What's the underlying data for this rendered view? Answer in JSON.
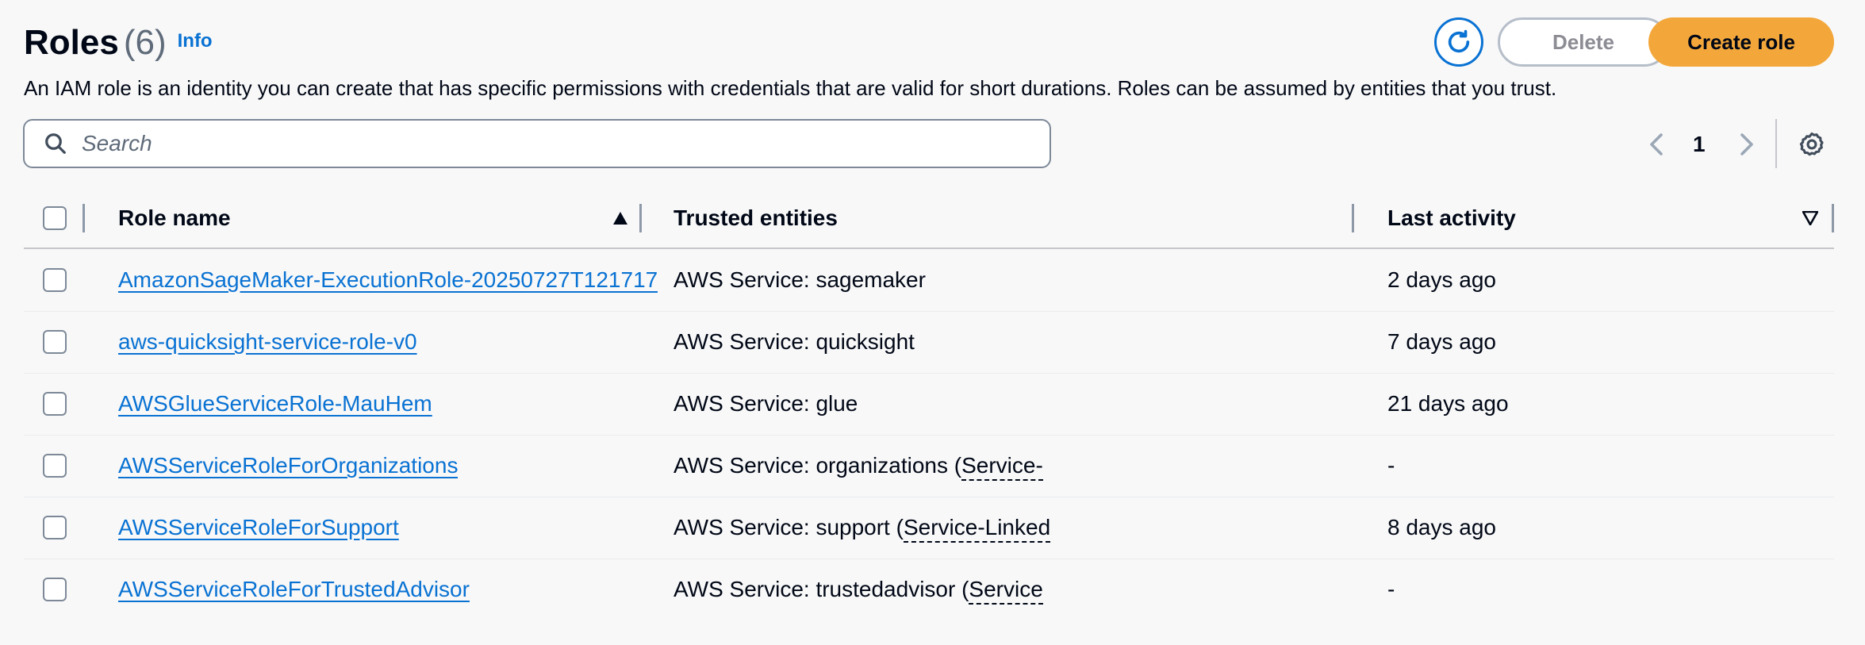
{
  "header": {
    "title": "Roles",
    "count": "(6)",
    "info_label": "Info",
    "description": "An IAM role is an identity you can create that has specific permissions with credentials that are valid for short durations. Roles can be assumed by entities that you trust."
  },
  "actions": {
    "refresh_icon": "refresh-icon",
    "delete_label": "Delete",
    "create_label": "Create role"
  },
  "search": {
    "placeholder": "Search"
  },
  "pagination": {
    "current_page": "1"
  },
  "table": {
    "columns": [
      "Role name",
      "Trusted entities",
      "Last activity"
    ],
    "rows": [
      {
        "role_name": "AmazonSageMaker-ExecutionRole-20250727T121717",
        "trusted": "AWS Service: sagemaker",
        "trusted_suffix": "",
        "last_activity": "2 days ago"
      },
      {
        "role_name": "aws-quicksight-service-role-v0",
        "trusted": "AWS Service: quicksight",
        "trusted_suffix": "",
        "last_activity": "7 days ago"
      },
      {
        "role_name": "AWSGlueServiceRole-MauHem",
        "trusted": "AWS Service: glue",
        "trusted_suffix": "",
        "last_activity": "21 days ago"
      },
      {
        "role_name": "AWSServiceRoleForOrganizations",
        "trusted": "AWS Service: organizations",
        "trusted_suffix": "Service-",
        "last_activity": "-"
      },
      {
        "role_name": "AWSServiceRoleForSupport",
        "trusted": "AWS Service: support",
        "trusted_suffix": "Service-Linked",
        "last_activity": "8 days ago"
      },
      {
        "role_name": "AWSServiceRoleForTrustedAdvisor",
        "trusted": "AWS Service: trustedadvisor",
        "trusted_suffix": "Service",
        "last_activity": "-"
      }
    ]
  },
  "colors": {
    "primary": "#f3a73b",
    "link": "#0972d3",
    "background": "#f8f8f8"
  }
}
